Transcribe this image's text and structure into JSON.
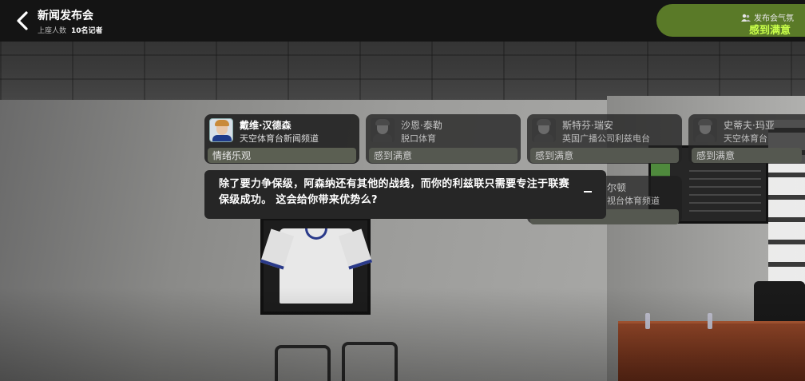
{
  "header": {
    "title": "新闻发布会",
    "seated_label": "上座人数",
    "seated_value": "10名记者",
    "mood_label": "发布会气氛",
    "mood_value": "感到满意"
  },
  "reporters": [
    {
      "name": "戴维·汉德森",
      "outlet": "天空体育台新闻频道",
      "status": "情绪乐观"
    },
    {
      "name": "沙恩·泰勒",
      "outlet": "脱口体育",
      "status": "感到满意"
    },
    {
      "name": "斯特芬·瑞安",
      "outlet": "英国广播公司利兹电台",
      "status": "感到满意"
    },
    {
      "name": "史蒂夫·玛亚",
      "outlet": "天空体育台",
      "status": "感到满意"
    }
  ],
  "hidden_reporter": {
    "name_fragment": "尔顿",
    "outlet_fragment": "视台体育频道"
  },
  "question": {
    "text": "除了要力争保级，阿森纳还有其他的战线，而你的利兹联只需要专注于联赛保级成功。 这会给你带来优势么?"
  },
  "icons": {
    "back": "chevron-left-icon",
    "mood": "people-icon",
    "minimize": "minimize-icon"
  },
  "colors": {
    "accent": "#c9ff4a",
    "mood_panel": "#5a7a28"
  }
}
